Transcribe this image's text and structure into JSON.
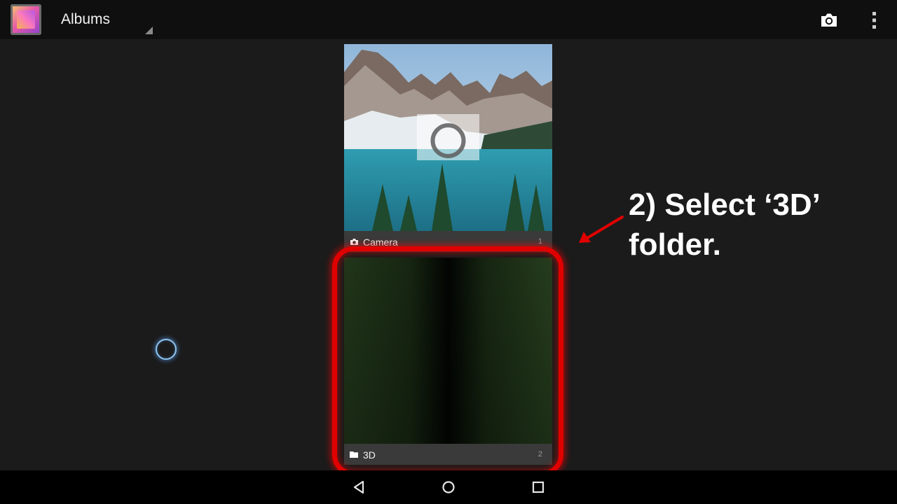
{
  "action_bar": {
    "title": "Albums",
    "icons": [
      "gallery-app-icon",
      "spinner-triangle-icon",
      "camera-icon",
      "overflow-menu-icon"
    ]
  },
  "albums": [
    {
      "label": "Camera",
      "count": "1",
      "icon": "camera-icon"
    },
    {
      "label": "3D",
      "count": "2",
      "icon": "folder-icon"
    }
  ],
  "annotation": {
    "line1": "2) Select ‘3D’",
    "line2": "folder.",
    "highlight_color": "#e00000"
  },
  "nav_bar": {
    "icons": [
      "back-icon",
      "home-icon",
      "recent-apps-icon"
    ]
  }
}
